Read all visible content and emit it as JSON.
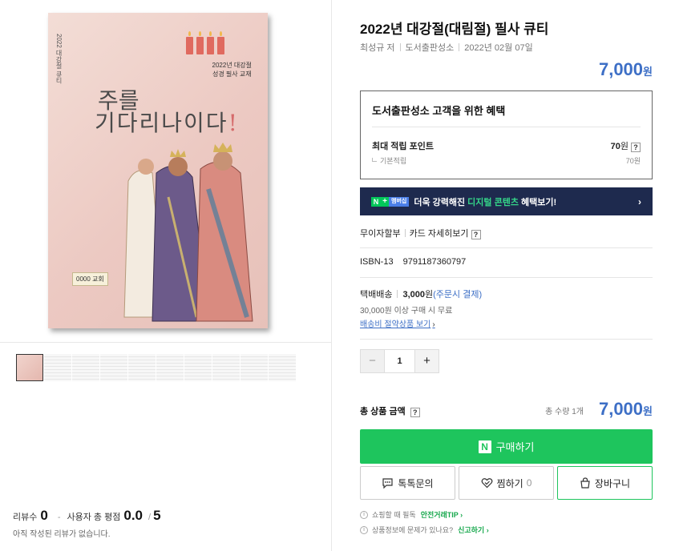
{
  "book_cover": {
    "spine_text": "2022 대강절 큐티",
    "subtitle_line1": "2022년 대강절",
    "subtitle_line2": "성경 필사 교재",
    "title_line1": "주를",
    "title_line2": "기다리나이다",
    "title_mark": "!",
    "church_badge": "0000 교회"
  },
  "thumbnails_count": 10,
  "review": {
    "count_label": "리뷰수",
    "count": "0",
    "score_label": "사용자 총 평점",
    "score": "0.0",
    "score_max": "5",
    "empty_text": "아직 작성된 리뷰가 없습니다."
  },
  "product": {
    "title": "2022년 대강절(대림절) 필사 큐티",
    "author": "최성규 저",
    "publisher": "도서출판성소",
    "date": "2022년 02월 07일",
    "price": "7,000",
    "currency": "원"
  },
  "benefit": {
    "title": "도서출판성소 고객을 위한 혜택",
    "max_point_label": "최대 적립 포인트",
    "max_point_value": "70",
    "base_label": "기본적립",
    "base_value": "70원"
  },
  "banner": {
    "n_label": "N",
    "plus_label": "+",
    "membership_label": "멤버십",
    "text_before": "더욱 강력해진 ",
    "highlight": "디지털 콘텐츠",
    "text_after": " 혜택보기!",
    "chevron": "›"
  },
  "installment": {
    "label": "무이자할부",
    "card_detail": "카드 자세히보기",
    "help": "?"
  },
  "isbn": {
    "label": "ISBN-13",
    "value": "9791187360797"
  },
  "shipping": {
    "label": "택배배송",
    "fee": "3,000",
    "fee_unit": "원",
    "payment_note": "(주문시 결제)",
    "free_condition": "30,000원 이상 구매 시 무료",
    "link": "배송비 절약상품 보기"
  },
  "quantity": {
    "minus": "−",
    "value": "1",
    "plus": "+"
  },
  "total": {
    "label": "총 상품 금액",
    "help": "?",
    "count_text": "총 수량 1개",
    "price": "7,000",
    "currency": "원"
  },
  "actions": {
    "buy_logo": "N",
    "buy_label": "구매하기",
    "talk_label": "톡톡문의",
    "wish_label": "찜하기",
    "wish_count": "0",
    "cart_label": "장바구니"
  },
  "tips": {
    "info_icon": "i",
    "safe_text": "쇼핑할 때 필독",
    "safe_link": "안전거래TIP ›",
    "report_text": "상품정보에 문제가 있나요?",
    "report_link": "신고하기 ›"
  },
  "colors": {
    "price_blue": "#3d6fc6",
    "buy_green": "#1ec55d",
    "banner_navy": "#1e2a4e",
    "banner_highlight": "#35d88a"
  }
}
